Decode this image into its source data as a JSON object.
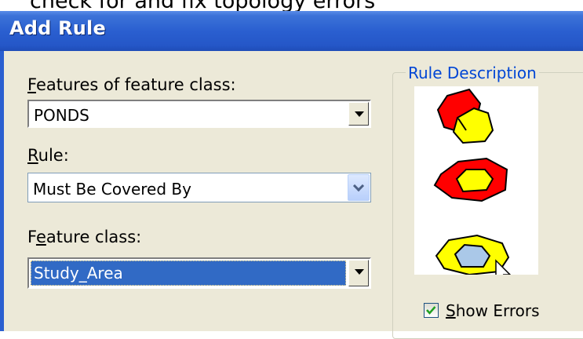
{
  "page_caption": "check for and fix topology errors",
  "window": {
    "title": "Add Rule"
  },
  "form": {
    "features_label_u": "F",
    "features_label_rest": "eatures of feature class:",
    "features_value": "PONDS",
    "rule_label_u": "R",
    "rule_label_rest": "ule:",
    "rule_value": "Must Be Covered By",
    "feature_class_label_pre": "F",
    "feature_class_label_u": "e",
    "feature_class_label_rest": "ature class:",
    "feature_class_value": "Study_Area"
  },
  "rule_description": {
    "title": "Rule Description",
    "show_errors_label_u": "S",
    "show_errors_label_rest": "how Errors",
    "show_errors_checked": true
  },
  "colors": {
    "title_bar": "#2a5fd0",
    "dialog_bg": "#ece9d8",
    "error_red": "#ff0000",
    "valid_yellow": "#ffff00",
    "error_fill": "#aac8e8",
    "selection_blue": "#316ac5"
  }
}
